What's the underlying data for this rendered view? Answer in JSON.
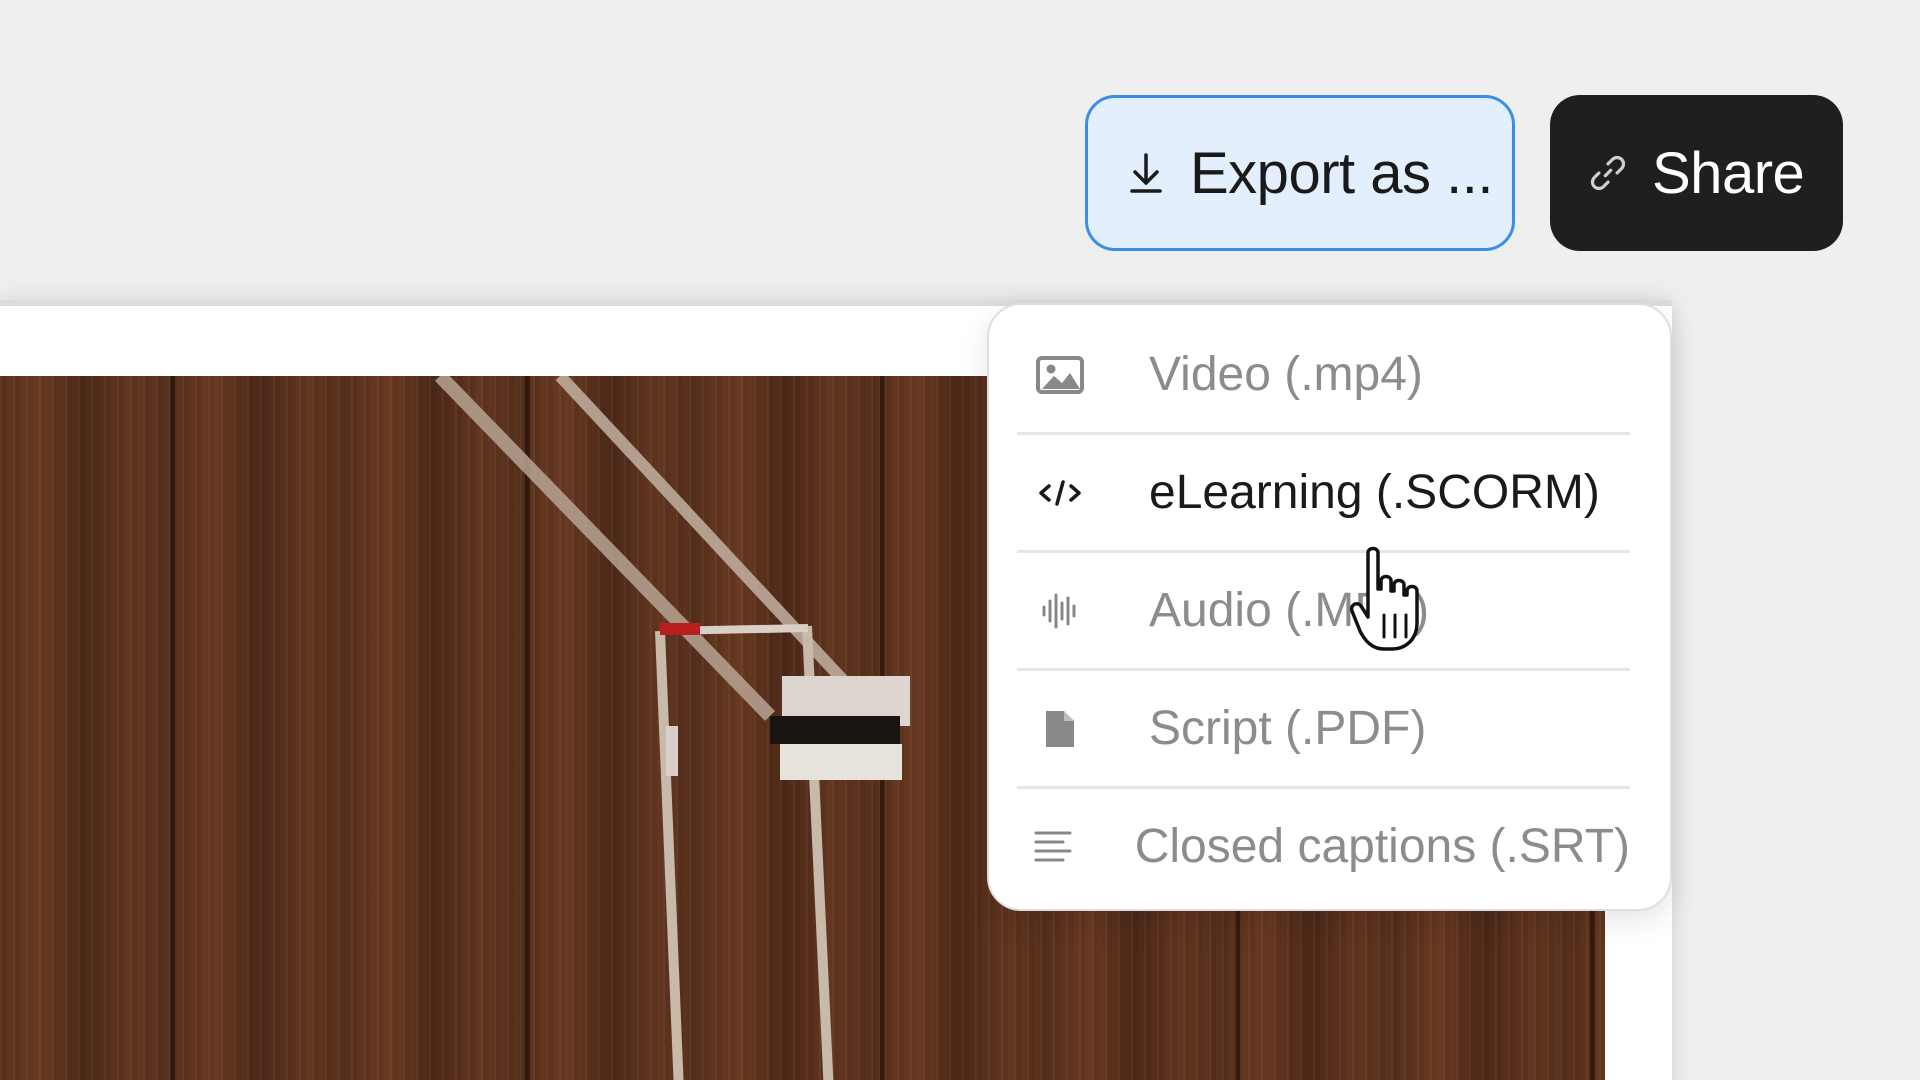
{
  "toolbar": {
    "export_label": "Export as ...",
    "export_icon": "download-icon",
    "share_label": "Share",
    "share_icon": "link-icon"
  },
  "export_menu": {
    "items": [
      {
        "label": "Video (.mp4)",
        "icon": "image-icon",
        "active": false
      },
      {
        "label": "eLearning (.SCORM)",
        "icon": "code-icon",
        "active": true
      },
      {
        "label": "Audio (.MP3)",
        "icon": "audio-waveform-icon",
        "active": false
      },
      {
        "label": "Script (.PDF)",
        "icon": "document-icon",
        "active": false
      },
      {
        "label": "Closed captions (.SRT)",
        "icon": "captions-lines-icon",
        "active": false
      }
    ]
  },
  "colors": {
    "background": "#efefef",
    "export_button_bg": "#e3effd",
    "export_button_border": "#3a8ee6",
    "share_button_bg": "#1f1f1f",
    "menu_text_muted": "#8c8c8c",
    "menu_text_active": "#1a1a1a"
  }
}
